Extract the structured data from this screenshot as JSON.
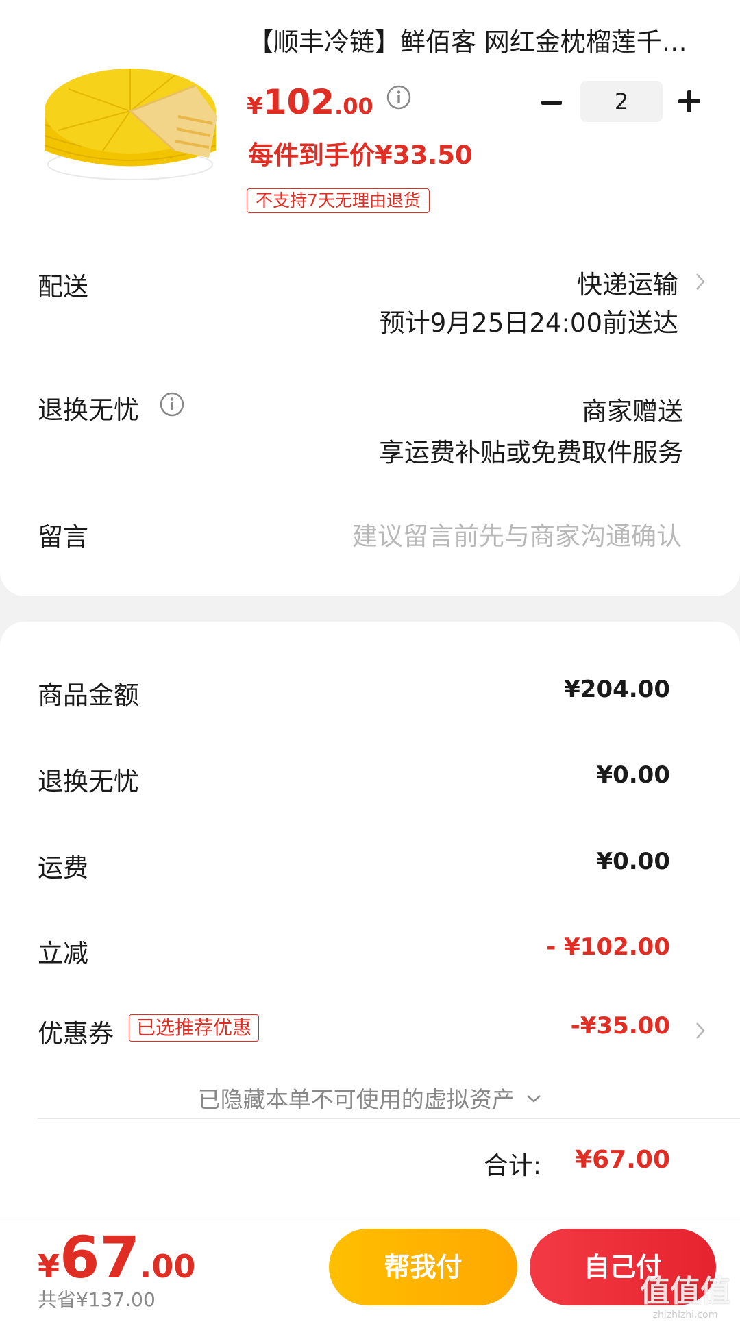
{
  "product": {
    "title": "【顺丰冷链】鲜佰客 网红金枕榴莲千层蛋糕",
    "price_currency": "¥",
    "price_int": "102",
    "price_dec": ".00",
    "quantity": "2",
    "unit_price": "每件到手价¥33.50",
    "no_return_tag": "不支持7天无理由退货"
  },
  "delivery": {
    "label": "配送",
    "method": "快递运输",
    "eta": "预计9月25日24:00前送达"
  },
  "return_worry_free": {
    "label": "退换无忧",
    "value_line1": "商家赠送",
    "value_line2": "享运费补贴或免费取件服务"
  },
  "message": {
    "label": "留言",
    "placeholder": "建议留言前先与商家沟通确认"
  },
  "summary": {
    "goods_label": "商品金额",
    "goods_value": "¥204.00",
    "return_label": "退换无忧",
    "return_value": "¥0.00",
    "shipping_label": "运费",
    "shipping_value": "¥0.00",
    "discount_label": "立减",
    "discount_value": "- ¥102.00",
    "coupon_label": "优惠券",
    "coupon_tag": "已选推荐优惠",
    "coupon_value": "-¥35.00",
    "hidden_assets": "已隐藏本单不可使用的虚拟资产",
    "total_label": "合计:",
    "total_value": "¥67.00"
  },
  "bottom_bar": {
    "pay_currency": "¥",
    "pay_int": "67",
    "pay_dec": ".00",
    "saved": "共省¥137.00",
    "help_pay": "帮我付",
    "self_pay": "自己付"
  },
  "watermark": {
    "big": "值值值",
    "small": "zhizhizhi.com"
  },
  "colors": {
    "accent_red": "#e02e24",
    "help_button": "#ffb400",
    "self_button": "#eb2d38"
  }
}
